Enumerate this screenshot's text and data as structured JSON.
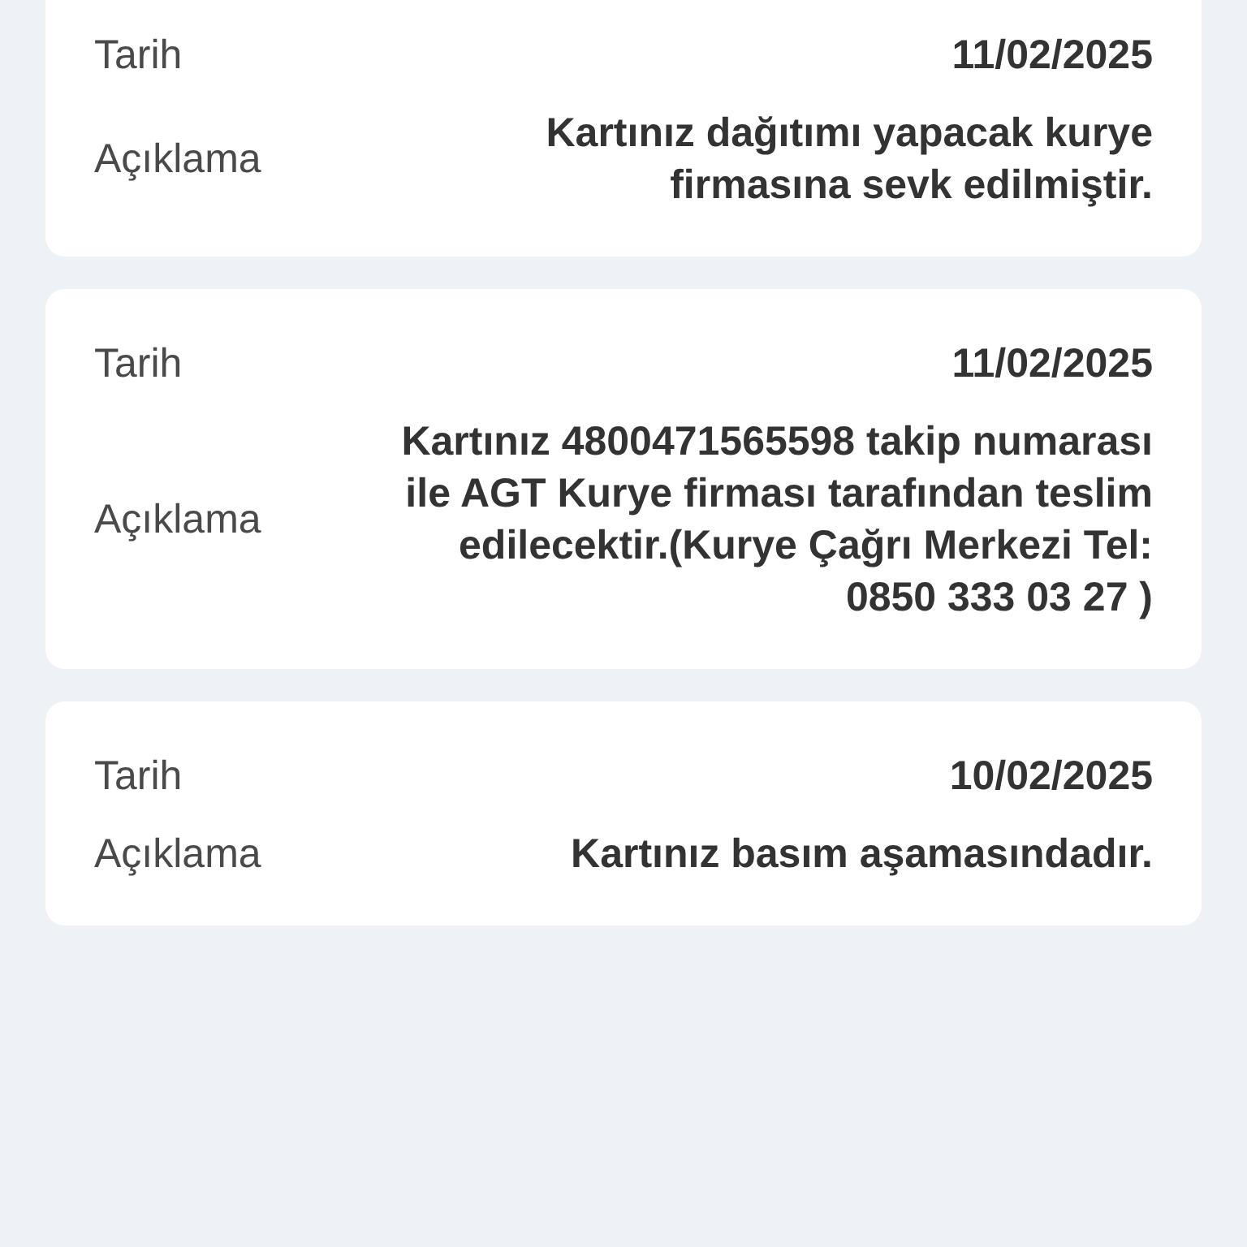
{
  "entries": [
    {
      "date_label": "Tarih",
      "date": "11/02/2025",
      "description_label": "Açıklama",
      "description": "Kartınız dağıtımı yapacak kurye firmasına sevk edilmiştir."
    },
    {
      "date_label": "Tarih",
      "date": "11/02/2025",
      "description_label": "Açıklama",
      "description": "Kartınız 4800471565598 takip numarası ile AGT Kurye firması tarafından teslim edilecektir.(Kurye Çağrı Merkezi Tel: 0850 333 03 27 )"
    },
    {
      "date_label": "Tarih",
      "date": "10/02/2025",
      "description_label": "Açıklama",
      "description": "Kartınız basım aşamasındadır."
    }
  ]
}
